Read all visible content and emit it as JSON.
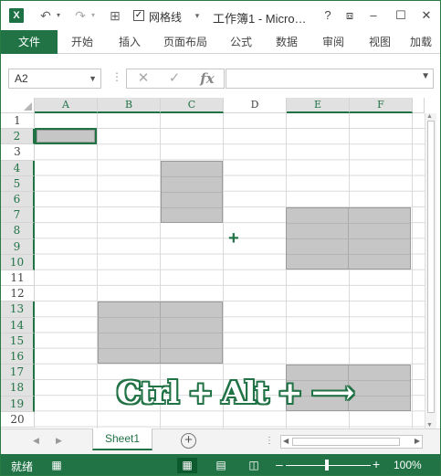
{
  "window": {
    "title": "工作簿1 - Micro…",
    "app_icon": "X",
    "gridlines_label": "网格线",
    "gridlines_checked": "✓",
    "controls": [
      "?",
      "⧈",
      "–",
      "☐",
      "✕"
    ]
  },
  "ribbon": {
    "tabs": [
      "文件",
      "开始",
      "插入",
      "页面布局",
      "公式",
      "数据",
      "审阅",
      "视图",
      "加载"
    ]
  },
  "formula_bar": {
    "name_box": "A2",
    "cancel_icon": "✕",
    "enter_icon": "✓",
    "fx_label": "fx",
    "formula_value": ""
  },
  "grid": {
    "columns": [
      "A",
      "B",
      "C",
      "D",
      "E",
      "F"
    ],
    "selected_columns": [
      "A",
      "B",
      "C",
      "E",
      "F"
    ],
    "rows": [
      "1",
      "2",
      "3",
      "4",
      "5",
      "6",
      "7",
      "8",
      "9",
      "10",
      "11",
      "12",
      "13",
      "14",
      "15",
      "16",
      "17",
      "18",
      "19",
      "20"
    ],
    "selected_rows": [
      "2",
      "4",
      "5",
      "6",
      "7",
      "8",
      "9",
      "10",
      "13",
      "14",
      "15",
      "16",
      "17",
      "18",
      "19"
    ],
    "selections": [
      "A2",
      "C4:C7",
      "E7:F10",
      "B13:C16",
      "E17:F19"
    ],
    "active_cell": "A2"
  },
  "overlay": {
    "shortcut_text": "Ctrl + Alt + ⟶",
    "cursor": "+"
  },
  "sheets": {
    "tabs": [
      "Sheet1"
    ],
    "active": "Sheet1"
  },
  "status_bar": {
    "ready_text": "就绪",
    "zoom_level": "100%",
    "zoom_fraction": 0.5
  },
  "colors": {
    "accent": "#217346",
    "selection_fill": "#c6c6c6",
    "header_highlight": "#e1e1e1"
  }
}
